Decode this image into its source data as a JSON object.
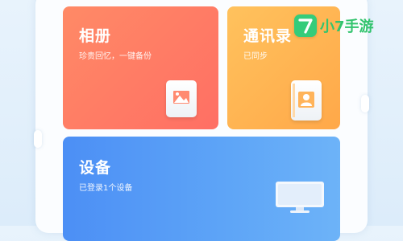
{
  "cards": {
    "album": {
      "title": "相册",
      "subtitle": "珍贵回忆，一键备份",
      "icon": "photo-icon"
    },
    "contacts": {
      "title": "通讯录",
      "subtitle": "已同步",
      "icon": "contact-card-icon"
    },
    "device": {
      "title": "设备",
      "subtitle": "已登录1个设备",
      "icon": "monitor-icon"
    }
  },
  "watermark": {
    "logo_glyph": "7",
    "text": "小7手游"
  },
  "colors": {
    "album": "#ff7a64",
    "contacts": "#ffb552",
    "device": "#5a9ef6",
    "logo_green": "#35cc7a"
  }
}
